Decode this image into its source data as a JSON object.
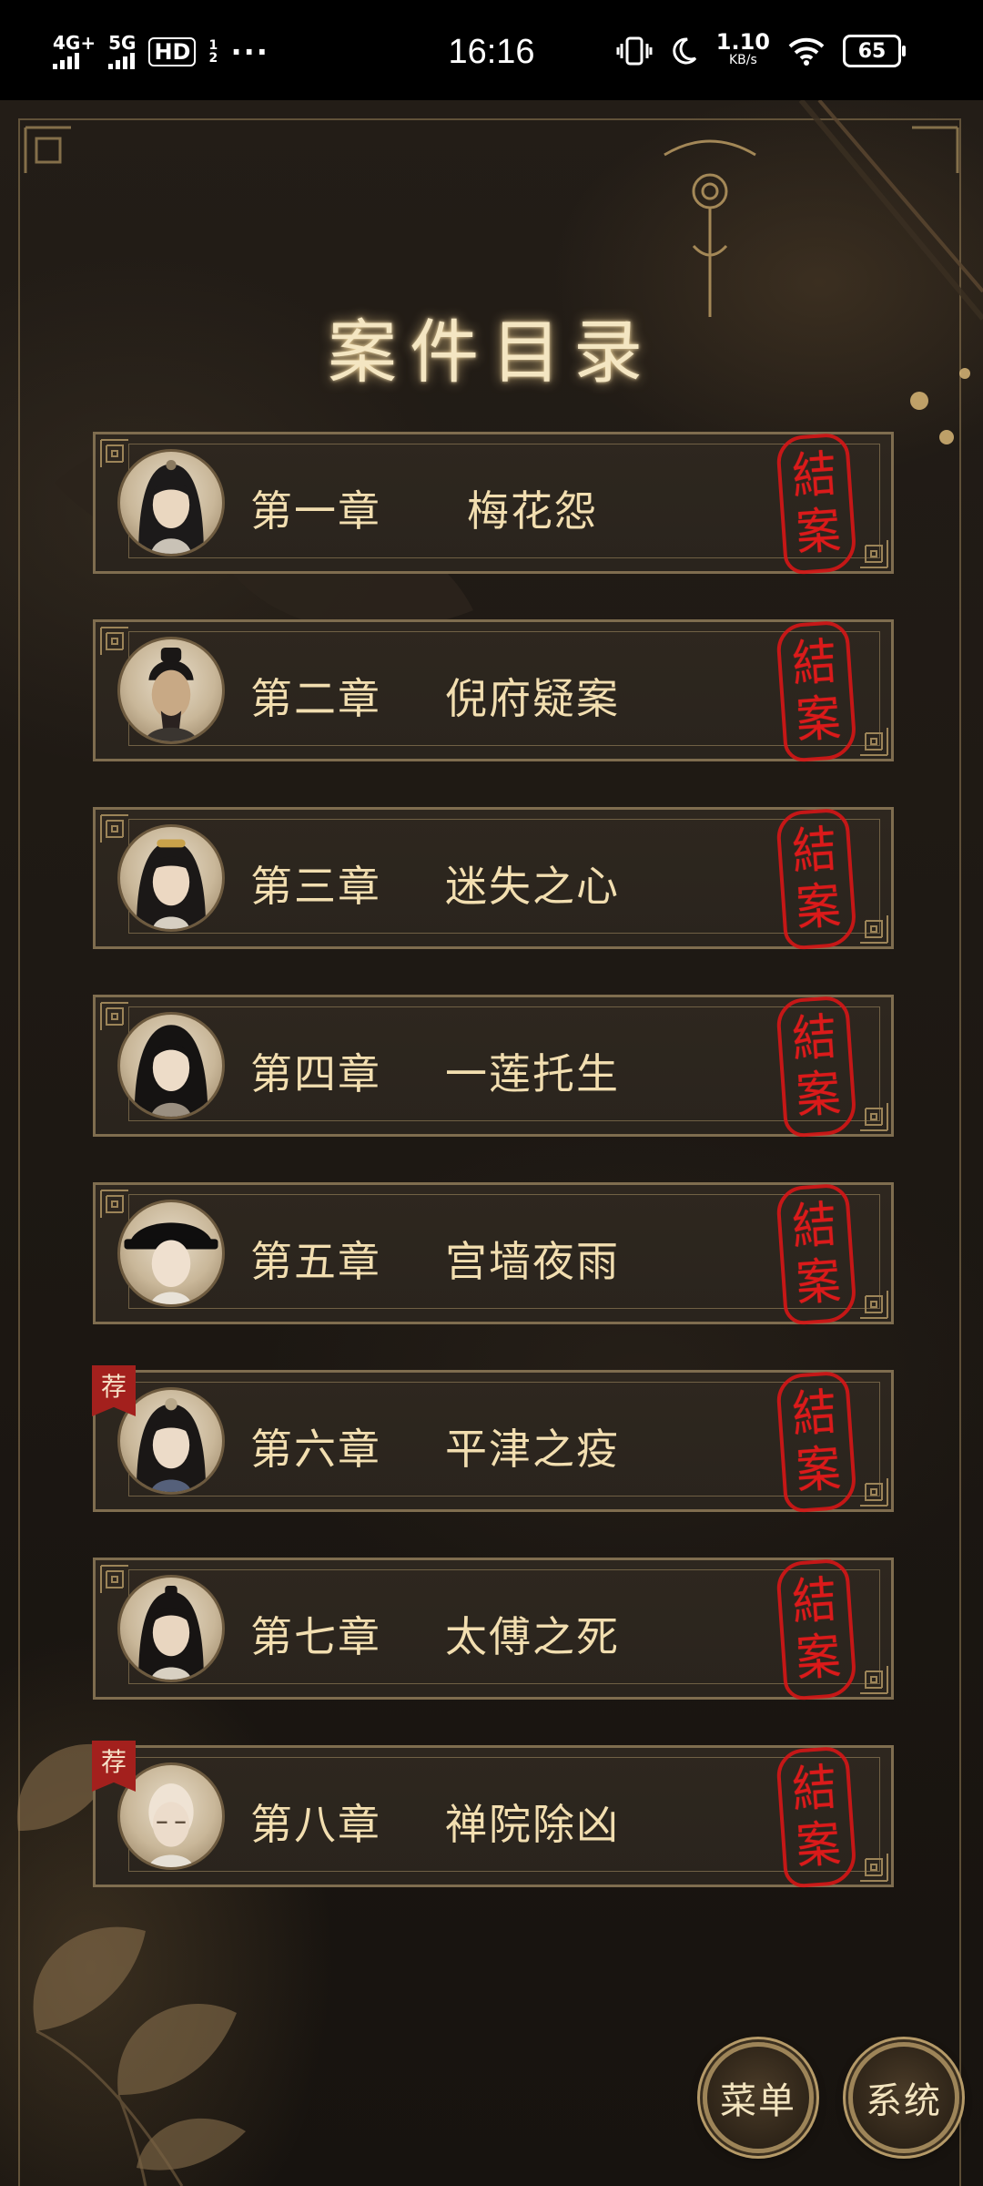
{
  "status_bar": {
    "network_1": "4G+",
    "network_2": "5G",
    "hd_badge": "HD",
    "hd_sub": "1 2",
    "more": "···",
    "time": "16:16",
    "speed_value": "1.10",
    "speed_unit": "KB/s",
    "battery": "65",
    "icons": [
      "vibrate-icon",
      "moon-icon",
      "wifi-icon",
      "battery-icon"
    ]
  },
  "page": {
    "title": "案件目录"
  },
  "chapters": [
    {
      "number": "第一章",
      "title": "梅花怨",
      "stamp_top": "結",
      "stamp_bottom": "案",
      "recommended": false
    },
    {
      "number": "第二章",
      "title": "倪府疑案",
      "stamp_top": "結",
      "stamp_bottom": "案",
      "recommended": false
    },
    {
      "number": "第三章",
      "title": "迷失之心",
      "stamp_top": "結",
      "stamp_bottom": "案",
      "recommended": false
    },
    {
      "number": "第四章",
      "title": "一莲托生",
      "stamp_top": "結",
      "stamp_bottom": "案",
      "recommended": false
    },
    {
      "number": "第五章",
      "title": "宫墙夜雨",
      "stamp_top": "結",
      "stamp_bottom": "案",
      "recommended": false
    },
    {
      "number": "第六章",
      "title": "平津之疫",
      "stamp_top": "結",
      "stamp_bottom": "案",
      "recommended": true,
      "tag": "荐"
    },
    {
      "number": "第七章",
      "title": "太傅之死",
      "stamp_top": "結",
      "stamp_bottom": "案",
      "recommended": false
    },
    {
      "number": "第八章",
      "title": "禅院除凶",
      "stamp_top": "結",
      "stamp_bottom": "案",
      "recommended": true,
      "tag": "荐"
    }
  ],
  "buttons": {
    "menu": "菜单",
    "system": "系统"
  },
  "colors": {
    "gold_text": "#f2deb0",
    "seal_red": "#e01a1a",
    "frame_gold": "#7f6d4f",
    "background": "#1d1813"
  }
}
